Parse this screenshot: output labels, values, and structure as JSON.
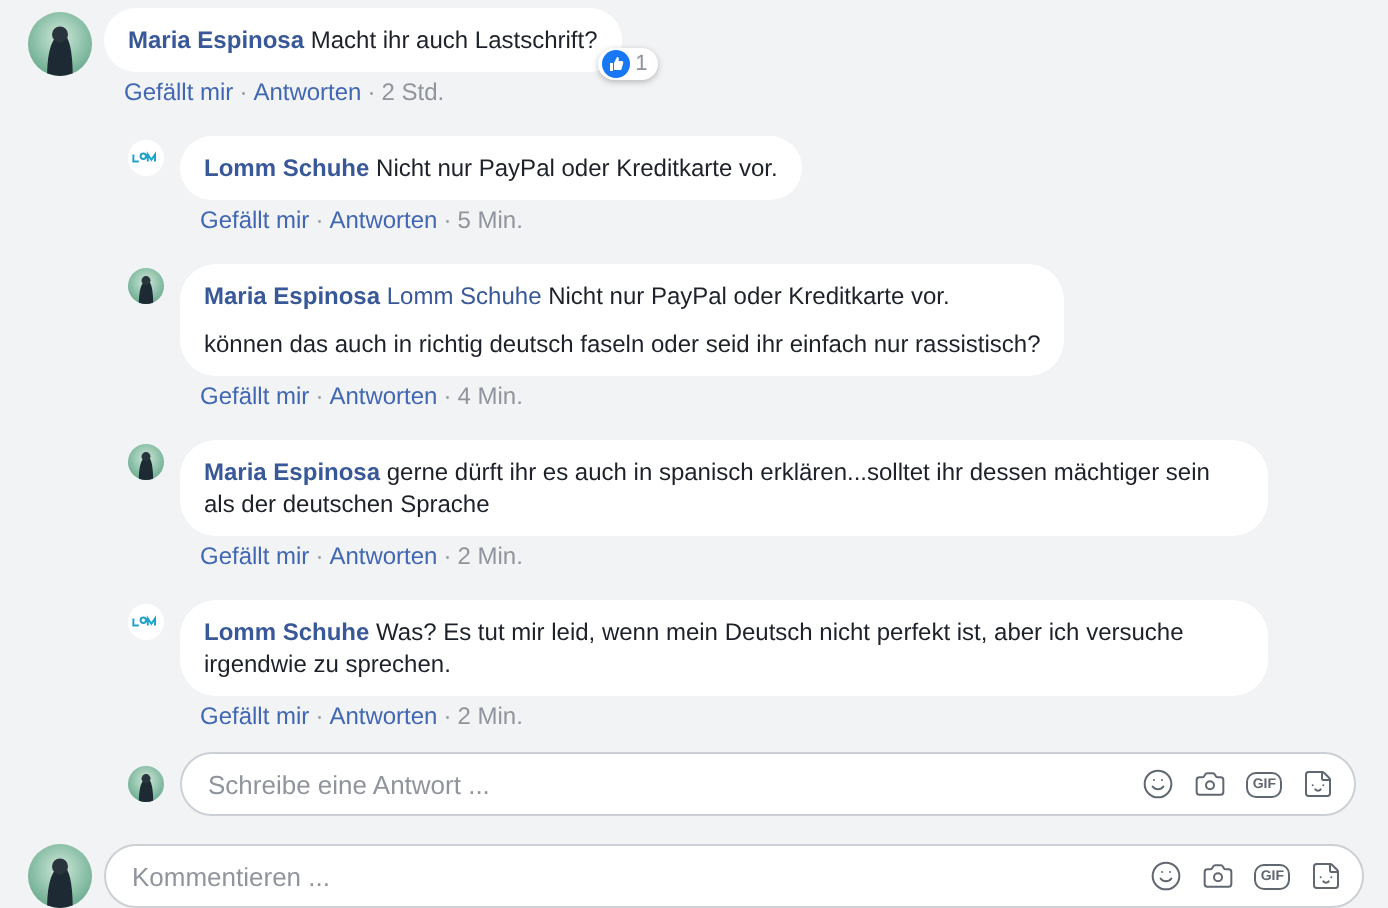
{
  "comment": {
    "author": "Maria Espinosa",
    "kind": "person",
    "text": "Macht ihr auch Lastschrift?",
    "likes": "1",
    "meta": [
      {
        "kind": "like",
        "text": "Gefällt mir"
      },
      {
        "kind": "separator",
        "text": "·"
      },
      {
        "kind": "reply",
        "text": "Antworten"
      },
      {
        "kind": "separator",
        "text": "·"
      },
      {
        "kind": "time",
        "text": "2 Std."
      }
    ]
  },
  "replies": [
    {
      "author": "Lomm Schuhe",
      "kind": "page",
      "lines": [
        "Nicht nur PayPal oder Kreditkarte vor."
      ],
      "meta": [
        {
          "kind": "like",
          "text": "Gefällt mir"
        },
        {
          "kind": "separator",
          "text": "·"
        },
        {
          "kind": "reply",
          "text": "Antworten"
        },
        {
          "kind": "separator",
          "text": "·"
        },
        {
          "kind": "time",
          "text": "5 Min."
        }
      ]
    },
    {
      "author": "Maria Espinosa",
      "kind": "person",
      "mention": "Lomm Schuhe",
      "lines": [
        "Nicht nur PayPal oder Kreditkarte vor.",
        "können das auch in richtig deutsch faseln oder seid ihr einfach nur rassistisch?"
      ],
      "meta": [
        {
          "kind": "like",
          "text": "Gefällt mir"
        },
        {
          "kind": "separator",
          "text": "·"
        },
        {
          "kind": "reply",
          "text": "Antworten"
        },
        {
          "kind": "separator",
          "text": "·"
        },
        {
          "kind": "time",
          "text": "4 Min."
        }
      ]
    },
    {
      "author": "Maria Espinosa",
      "kind": "person",
      "lines": [
        "gerne dürft ihr es auch in spanisch erklären...solltet ihr dessen mächtiger sein als der deutschen Sprache"
      ],
      "meta": [
        {
          "kind": "like",
          "text": "Gefällt mir"
        },
        {
          "kind": "separator",
          "text": "·"
        },
        {
          "kind": "reply",
          "text": "Antworten"
        },
        {
          "kind": "separator",
          "text": "·"
        },
        {
          "kind": "time",
          "text": "2 Min."
        }
      ]
    },
    {
      "author": "Lomm Schuhe",
      "kind": "page",
      "lines": [
        "Was? Es tut mir leid, wenn mein Deutsch nicht perfekt ist, aber ich versuche irgendwie zu sprechen."
      ],
      "meta": [
        {
          "kind": "like",
          "text": "Gefällt mir"
        },
        {
          "kind": "separator",
          "text": "·"
        },
        {
          "kind": "reply",
          "text": "Antworten"
        },
        {
          "kind": "separator",
          "text": "·"
        },
        {
          "kind": "time",
          "text": "2 Min."
        }
      ]
    }
  ],
  "reply_box": {
    "placeholder": "Schreibe eine Antwort ...",
    "gif_label": "GIF"
  },
  "comment_box": {
    "placeholder": "Kommentieren ...",
    "gif_label": "GIF"
  }
}
